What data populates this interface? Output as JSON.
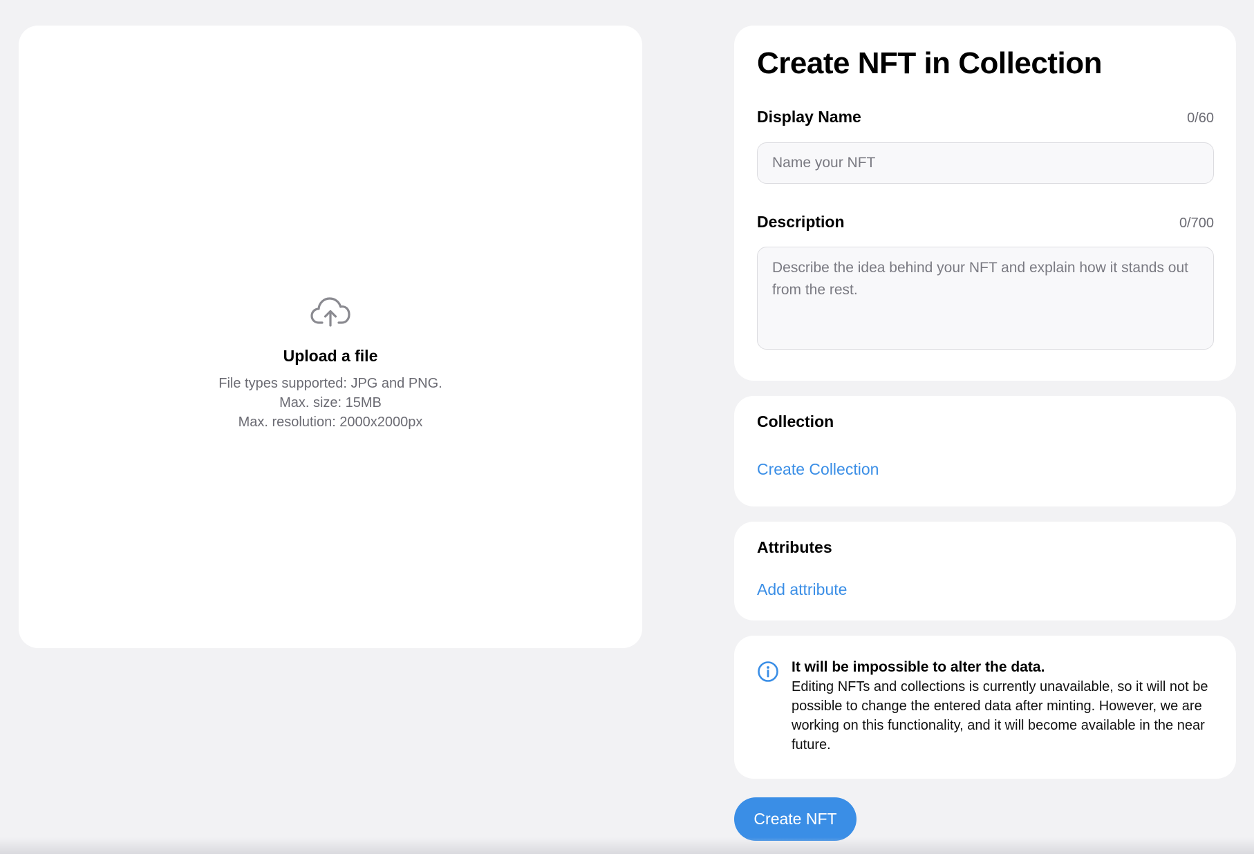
{
  "upload": {
    "icon": "cloud-upload-icon",
    "title": "Upload a file",
    "lines": [
      "File types supported: JPG and PNG.",
      "Max. size: 15MB",
      "Max. resolution: 2000x2000px"
    ]
  },
  "form": {
    "title": "Create NFT in Collection",
    "display_name": {
      "label": "Display Name",
      "count": "0/60",
      "placeholder": "Name your NFT",
      "value": ""
    },
    "description": {
      "label": "Description",
      "count": "0/700",
      "placeholder": "Describe the idea behind your NFT and explain how it stands out from the rest.",
      "value": ""
    }
  },
  "collection": {
    "label": "Collection",
    "link": "Create Collection"
  },
  "attributes": {
    "label": "Attributes",
    "link": "Add attribute"
  },
  "notice": {
    "icon": "info-icon",
    "title": "It will be impossible to alter the data.",
    "body": "Editing NFTs and collections is currently unavailable, so it will not be possible to change the entered data after minting. However, we are working on this functionality, and it will become available in the near future."
  },
  "actions": {
    "create_label": "Create NFT"
  },
  "colors": {
    "accent": "#3a8ee6",
    "background": "#f2f2f4",
    "card": "#ffffff",
    "muted_text": "#6b6b73"
  }
}
